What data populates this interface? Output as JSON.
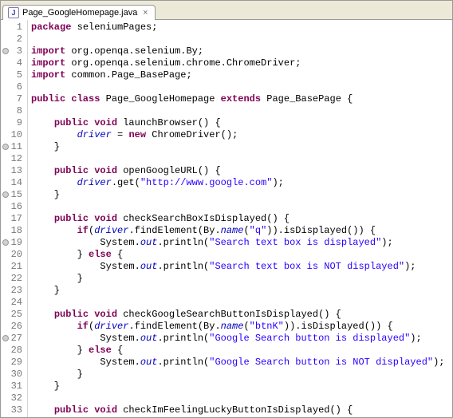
{
  "tab": {
    "icon_letter": "J",
    "title": "Page_GoogleHomepage.java",
    "close": "×"
  },
  "lines": [
    {
      "n": 1,
      "marker": false,
      "segs": [
        [
          "kw",
          "package"
        ],
        [
          "",
          " seleniumPages;"
        ]
      ]
    },
    {
      "n": 2,
      "marker": false,
      "segs": []
    },
    {
      "n": 3,
      "marker": true,
      "segs": [
        [
          "kw",
          "import"
        ],
        [
          "",
          " org.openqa.selenium.By;"
        ]
      ]
    },
    {
      "n": 4,
      "marker": false,
      "segs": [
        [
          "kw",
          "import"
        ],
        [
          "",
          " org.openqa.selenium.chrome.ChromeDriver;"
        ]
      ]
    },
    {
      "n": 5,
      "marker": false,
      "segs": [
        [
          "kw",
          "import"
        ],
        [
          "",
          " common.Page_BasePage;"
        ]
      ]
    },
    {
      "n": 6,
      "marker": false,
      "segs": []
    },
    {
      "n": 7,
      "marker": false,
      "segs": [
        [
          "kw",
          "public class"
        ],
        [
          "",
          " Page_GoogleHomepage "
        ],
        [
          "kw",
          "extends"
        ],
        [
          "",
          " Page_BasePage {"
        ]
      ]
    },
    {
      "n": 8,
      "marker": false,
      "segs": []
    },
    {
      "n": 9,
      "marker": false,
      "segs": [
        [
          "",
          "    "
        ],
        [
          "kw",
          "public void"
        ],
        [
          "",
          " launchBrowser() {"
        ]
      ]
    },
    {
      "n": 10,
      "marker": false,
      "segs": [
        [
          "",
          "        "
        ],
        [
          "field",
          "driver"
        ],
        [
          "",
          " = "
        ],
        [
          "kw",
          "new"
        ],
        [
          "",
          " ChromeDriver();"
        ]
      ]
    },
    {
      "n": 11,
      "marker": true,
      "segs": [
        [
          "",
          "    }"
        ]
      ]
    },
    {
      "n": 12,
      "marker": false,
      "segs": []
    },
    {
      "n": 13,
      "marker": false,
      "segs": [
        [
          "",
          "    "
        ],
        [
          "kw",
          "public void"
        ],
        [
          "",
          " openGoogleURL() {"
        ]
      ]
    },
    {
      "n": 14,
      "marker": false,
      "segs": [
        [
          "",
          "        "
        ],
        [
          "field",
          "driver"
        ],
        [
          "",
          ".get("
        ],
        [
          "str",
          "\"http://www.google.com\""
        ],
        [
          "",
          ");"
        ]
      ]
    },
    {
      "n": 15,
      "marker": true,
      "segs": [
        [
          "",
          "    }"
        ]
      ]
    },
    {
      "n": 16,
      "marker": false,
      "segs": []
    },
    {
      "n": 17,
      "marker": false,
      "segs": [
        [
          "",
          "    "
        ],
        [
          "kw",
          "public void"
        ],
        [
          "",
          " checkSearchBoxIsDisplayed() {"
        ]
      ]
    },
    {
      "n": 18,
      "marker": false,
      "segs": [
        [
          "",
          "        "
        ],
        [
          "kw",
          "if"
        ],
        [
          "",
          "("
        ],
        [
          "field",
          "driver"
        ],
        [
          "",
          ".findElement(By."
        ],
        [
          "staticf",
          "name"
        ],
        [
          "",
          "("
        ],
        [
          "str",
          "\"q\""
        ],
        [
          "",
          ")).isDisplayed()) {"
        ]
      ]
    },
    {
      "n": 19,
      "marker": true,
      "segs": [
        [
          "",
          "            System."
        ],
        [
          "staticf",
          "out"
        ],
        [
          "",
          ".println("
        ],
        [
          "str",
          "\"Search text box is displayed\""
        ],
        [
          "",
          ");"
        ]
      ]
    },
    {
      "n": 20,
      "marker": false,
      "segs": [
        [
          "",
          "        } "
        ],
        [
          "kw",
          "else"
        ],
        [
          "",
          " {"
        ]
      ]
    },
    {
      "n": 21,
      "marker": false,
      "segs": [
        [
          "",
          "            System."
        ],
        [
          "staticf",
          "out"
        ],
        [
          "",
          ".println("
        ],
        [
          "str",
          "\"Search text box is NOT displayed\""
        ],
        [
          "",
          ");"
        ]
      ]
    },
    {
      "n": 22,
      "marker": false,
      "segs": [
        [
          "",
          "        }"
        ]
      ]
    },
    {
      "n": 23,
      "marker": false,
      "segs": [
        [
          "",
          "    }"
        ]
      ]
    },
    {
      "n": 24,
      "marker": false,
      "segs": []
    },
    {
      "n": 25,
      "marker": false,
      "segs": [
        [
          "",
          "    "
        ],
        [
          "kw",
          "public void"
        ],
        [
          "",
          " checkGoogleSearchButtonIsDisplayed() {"
        ]
      ]
    },
    {
      "n": 26,
      "marker": false,
      "segs": [
        [
          "",
          "        "
        ],
        [
          "kw",
          "if"
        ],
        [
          "",
          "("
        ],
        [
          "field",
          "driver"
        ],
        [
          "",
          ".findElement(By."
        ],
        [
          "staticf",
          "name"
        ],
        [
          "",
          "("
        ],
        [
          "str",
          "\"btnK\""
        ],
        [
          "",
          ")).isDisplayed()) {"
        ]
      ]
    },
    {
      "n": 27,
      "marker": true,
      "segs": [
        [
          "",
          "            System."
        ],
        [
          "staticf",
          "out"
        ],
        [
          "",
          ".println("
        ],
        [
          "str",
          "\"Google Search button is displayed\""
        ],
        [
          "",
          ");"
        ]
      ]
    },
    {
      "n": 28,
      "marker": false,
      "segs": [
        [
          "",
          "        } "
        ],
        [
          "kw",
          "else"
        ],
        [
          "",
          " {"
        ]
      ]
    },
    {
      "n": 29,
      "marker": false,
      "segs": [
        [
          "",
          "            System."
        ],
        [
          "staticf",
          "out"
        ],
        [
          "",
          ".println("
        ],
        [
          "str",
          "\"Google Search button is NOT displayed\""
        ],
        [
          "",
          ");"
        ]
      ]
    },
    {
      "n": 30,
      "marker": false,
      "segs": [
        [
          "",
          "        }"
        ]
      ]
    },
    {
      "n": 31,
      "marker": false,
      "segs": [
        [
          "",
          "    }"
        ]
      ]
    },
    {
      "n": 32,
      "marker": false,
      "segs": []
    },
    {
      "n": 33,
      "marker": false,
      "segs": [
        [
          "",
          "    "
        ],
        [
          "kw",
          "public void"
        ],
        [
          "",
          " checkImFeelingLuckyButtonIsDisplayed() {"
        ]
      ]
    }
  ]
}
